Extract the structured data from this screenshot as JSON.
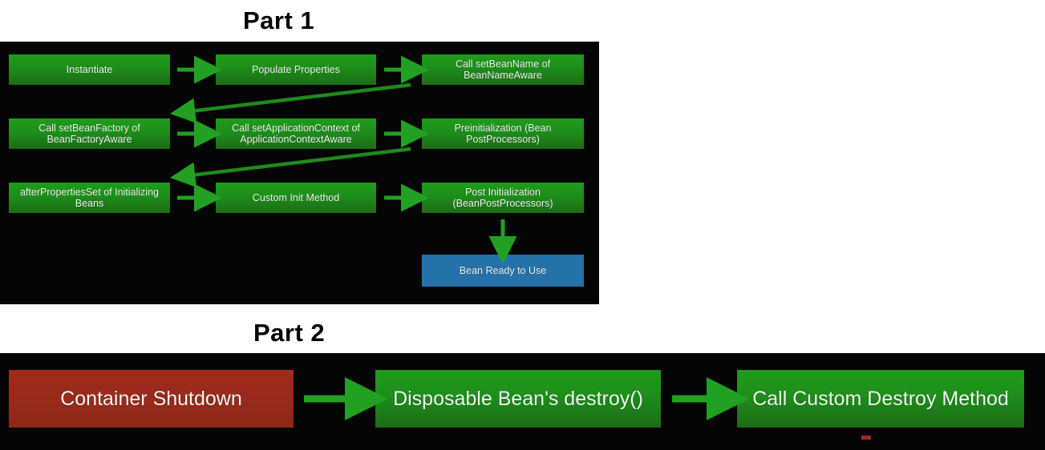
{
  "page": {
    "background": "#ffffff",
    "panel_color": "#050505",
    "accent_green": "#1d8e1a",
    "arrow_green": "#22a022",
    "node_blue": "#2472a8",
    "node_red": "#9e2b1b",
    "text_color": "#f2f7f2",
    "title_color": "#000000"
  },
  "part1": {
    "title": "Part 1",
    "nodes": [
      {
        "id": "instantiate",
        "label": "Instantiate",
        "color": "green"
      },
      {
        "id": "populate-properties",
        "label": "Populate Properties",
        "color": "green"
      },
      {
        "id": "set-bean-name",
        "label": "Call setBeanName of BeanNameAware",
        "color": "green"
      },
      {
        "id": "set-bean-factory",
        "label": "Call setBeanFactory of BeanFactoryAware",
        "color": "green"
      },
      {
        "id": "set-app-context",
        "label": "Call setApplicationContext of ApplicationContextAware",
        "color": "green"
      },
      {
        "id": "preinitialization",
        "label": "Preinitialization (Bean PostProcessors)",
        "color": "green"
      },
      {
        "id": "after-properties-set",
        "label": "afterPropertiesSet of Initializing Beans",
        "color": "green"
      },
      {
        "id": "custom-init-method",
        "label": "Custom Init Method",
        "color": "green"
      },
      {
        "id": "post-initialization",
        "label": "Post Initialization (BeanPostProcessors)",
        "color": "green"
      },
      {
        "id": "bean-ready",
        "label": "Bean Ready to Use",
        "color": "blue"
      }
    ],
    "labels": {
      "instantiate": "Instantiate",
      "populate_properties": "Populate Properties",
      "set_bean_name_l1": "Call setBeanName of",
      "set_bean_name_l2": "BeanNameAware",
      "set_bean_factory_l1": "Call setBeanFactory of",
      "set_bean_factory_l2": "BeanFactoryAware",
      "set_app_context_l1": "Call setApplicationContext of",
      "set_app_context_l2": "ApplicationContextAware",
      "preinitialization_l1": "Preinitialization (Bean",
      "preinitialization_l2": "PostProcessors)",
      "after_properties_set_l1": "afterPropertiesSet of Initializing",
      "after_properties_set_l2": "Beans",
      "custom_init_method": "Custom Init Method",
      "post_initialization_l1": "Post Initialization",
      "post_initialization_l2": "(BeanPostProcessors)",
      "bean_ready": "Bean Ready to Use"
    },
    "connectors": [
      {
        "id": "arrow-instantiate-to-populate",
        "type": "horizontal-right"
      },
      {
        "id": "arrow-populate-to-setbeanname",
        "type": "horizontal-right"
      },
      {
        "id": "arrow-setbeanname-to-setbeanfactory",
        "type": "diagonal-left"
      },
      {
        "id": "arrow-setbeanfactory-to-appcontext",
        "type": "horizontal-right"
      },
      {
        "id": "arrow-appcontext-to-preinit",
        "type": "horizontal-right"
      },
      {
        "id": "arrow-preinit-to-afterprops",
        "type": "diagonal-left"
      },
      {
        "id": "arrow-afterprops-to-custominit",
        "type": "horizontal-right"
      },
      {
        "id": "arrow-custominit-to-postinit",
        "type": "horizontal-right"
      },
      {
        "id": "arrow-postinit-to-beanready",
        "type": "vertical-down"
      }
    ]
  },
  "part2": {
    "title": "Part 2",
    "nodes": [
      {
        "id": "container-shutdown",
        "label": "Container Shutdown",
        "color": "red"
      },
      {
        "id": "disposable-destroy",
        "label": "Disposable Bean's destroy()",
        "color": "green"
      },
      {
        "id": "custom-destroy",
        "label": "Call Custom Destroy Method",
        "color": "green"
      }
    ],
    "labels": {
      "container_shutdown": "Container Shutdown",
      "disposable_destroy": "Disposable Bean's destroy()",
      "custom_destroy": "Call Custom Destroy Method"
    },
    "connectors": [
      {
        "id": "arrow-shutdown-to-destroy",
        "type": "horizontal-right"
      },
      {
        "id": "arrow-destroy-to-customdestroy",
        "type": "horizontal-right"
      }
    ]
  }
}
